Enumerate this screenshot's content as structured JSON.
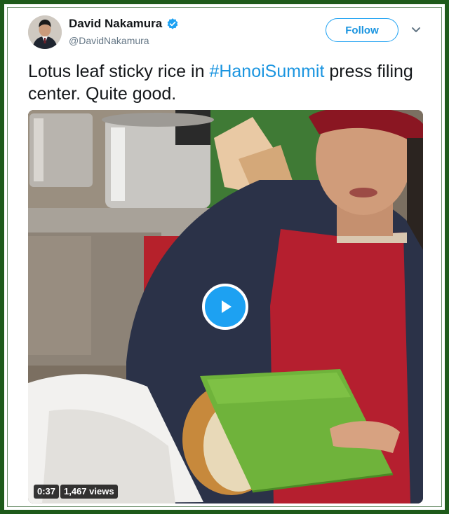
{
  "tweet": {
    "author_name": "David Nakamura",
    "author_handle": "@DavidNakamura",
    "verified_icon": "verified-badge-icon",
    "follow_label": "Follow",
    "text_before": "Lotus leaf sticky rice in ",
    "hashtag": "#HanoiSummit",
    "text_after": " press filing center. Quite good."
  },
  "video": {
    "duration": "0:37",
    "views": "1,467 views",
    "play_icon": "play-icon"
  },
  "colors": {
    "accent": "#1da1f2",
    "link": "#1b95e0",
    "frame": "#1e5a1a"
  }
}
